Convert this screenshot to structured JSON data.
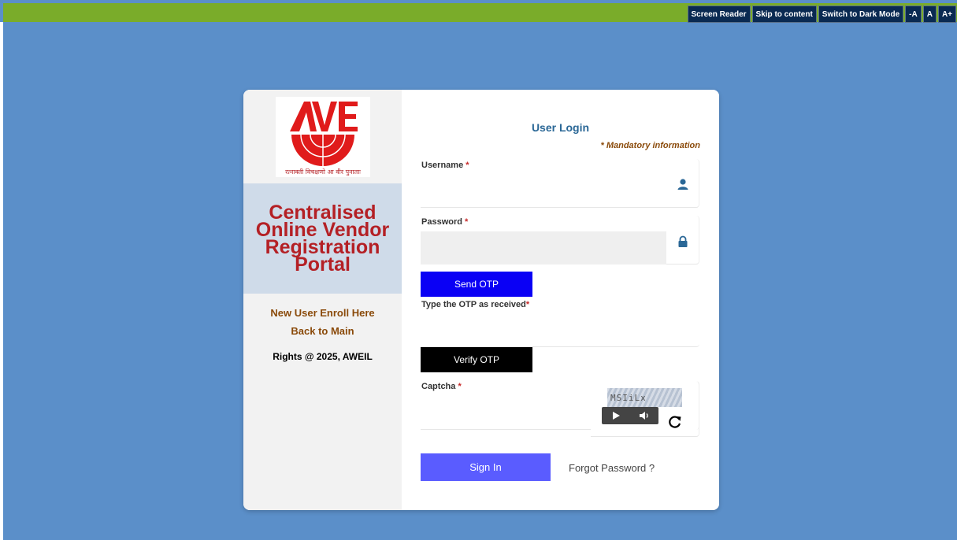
{
  "accessibility": {
    "screen_reader": "Screen Reader",
    "skip_content": "Skip to content",
    "dark_mode": "Switch to Dark Mode",
    "font_smaller": "-A",
    "font_normal": "A",
    "font_larger": "A+"
  },
  "logo": {
    "text": "AWE",
    "motto": "रत्नाक्ती विचक्षणो आ वीर पुनाताः"
  },
  "portal_title": "Centralised Online Vendor Registration Portal",
  "left_links": {
    "enroll": "New User Enroll Here",
    "back": "Back to Main"
  },
  "rights": "Rights @ 2025, AWEIL",
  "login": {
    "title": "User Login",
    "mandatory": "* Mandatory information",
    "username_label": "Username",
    "password_label": "Password",
    "required_mark": "*",
    "send_otp": "Send OTP",
    "otp_label": "Type the OTP as received",
    "verify_otp": "Verify OTP",
    "captcha_label": "Captcha",
    "captcha_text": "MSIiLx",
    "sign_in": "Sign In",
    "forgot": "Forgot Password ?"
  },
  "icons": {
    "user": "user-icon",
    "lock": "lock-icon",
    "play": "play-icon",
    "volume": "volume-icon",
    "refresh": "refresh-icon"
  },
  "colors": {
    "background": "#5b8fc9",
    "top_bar": "#7aac2a",
    "send_otp": "#0a00f5",
    "verify_otp": "#000000",
    "sign_in": "#5a5cff",
    "title_red": "#b42025"
  }
}
